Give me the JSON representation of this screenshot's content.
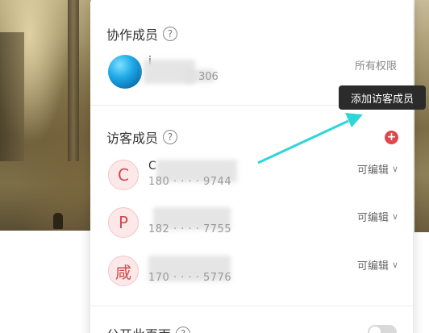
{
  "collaborators": {
    "title": "协作成员",
    "owner": {
      "name": "i",
      "sub": "306",
      "role": "所有权限"
    }
  },
  "visitors": {
    "title": "访客成员",
    "add_tooltip": "添加访客成员",
    "add_symbol": "+",
    "members": [
      {
        "initial": "C",
        "name": "C",
        "phone": "180 · · · · 9744",
        "role": "可编辑"
      },
      {
        "initial": "P",
        "name": "",
        "phone": "182 · · · · 7755",
        "role": "可编辑"
      },
      {
        "initial": "咸",
        "name": "",
        "phone": "170 · · · · 5776",
        "role": "可编辑"
      }
    ]
  },
  "public_page": {
    "label": "公开此页面"
  },
  "icons": {
    "help": "help-circle-icon",
    "chevron": "chevron-down-icon",
    "add": "plus-circle-icon"
  },
  "colors": {
    "accent_red": "#e0474c",
    "annotation_arrow": "#2fd6d9",
    "tooltip_bg": "#2b2b2b"
  }
}
